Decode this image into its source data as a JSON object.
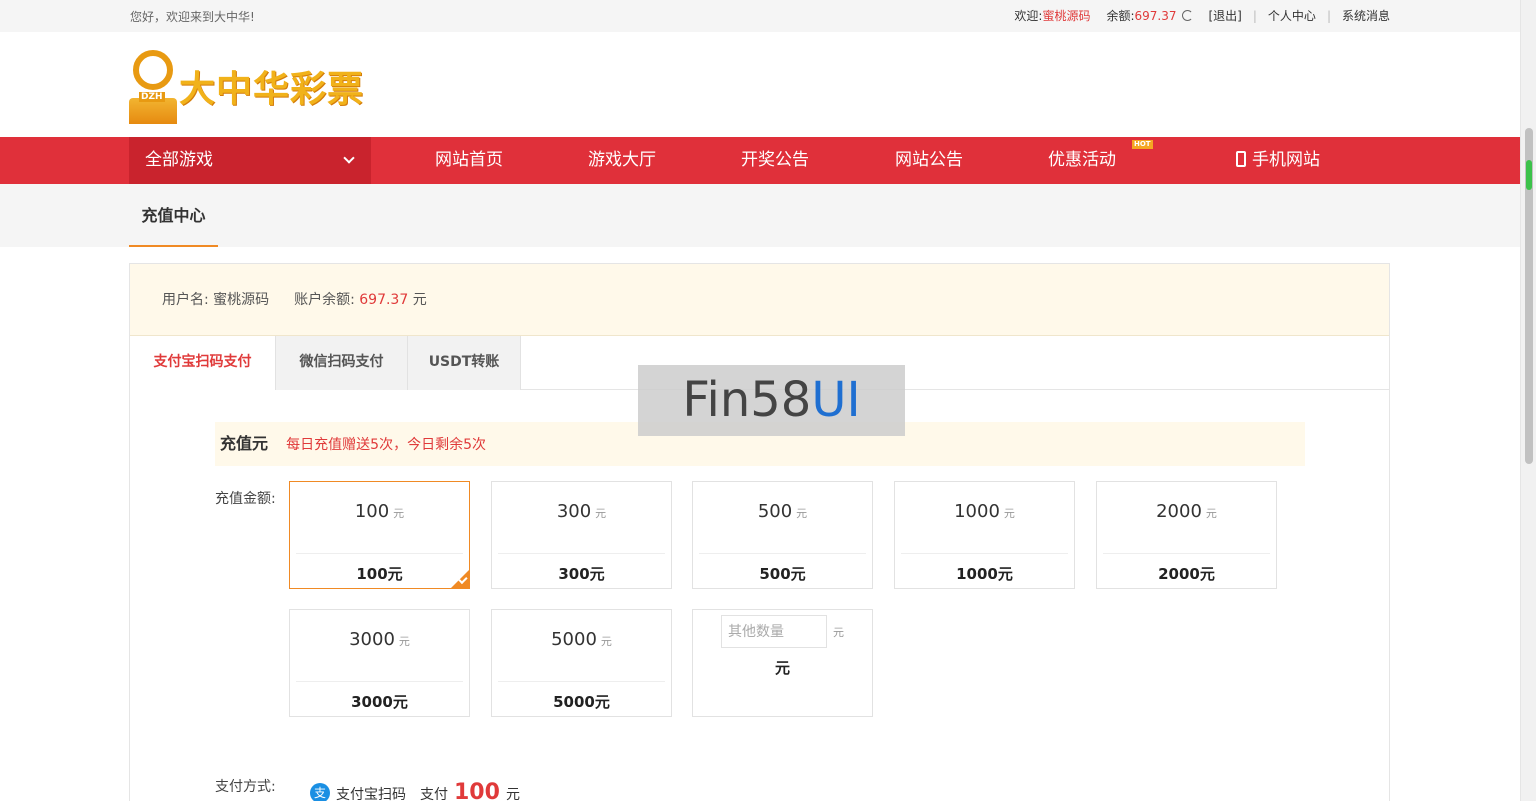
{
  "topbar": {
    "welcome": "您好，欢迎来到大中华!",
    "greeting_label": "欢迎:",
    "username": "蜜桃源码",
    "balance_label": "余额:",
    "balance_value": "697.37",
    "logout": "[退出]",
    "profile": "个人中心",
    "messages": "系统消息"
  },
  "logo": {
    "text": "大中华彩票",
    "badge": "DZH"
  },
  "nav": {
    "all_games": "全部游戏",
    "items": [
      "网站首页",
      "游戏大厅",
      "开奖公告",
      "网站公告",
      "优惠活动",
      "手机网站"
    ],
    "hot_badge": "HOT"
  },
  "page": {
    "title": "充值中心"
  },
  "userinfo": {
    "username_label": "用户名:",
    "username": "蜜桃源码",
    "balance_label": "账户余额:",
    "balance": "697.37",
    "unit": "元"
  },
  "tabs": [
    "支付宝扫码支付",
    "微信扫码支付",
    "USDT转账"
  ],
  "notice": {
    "label": "充值元",
    "message": "每日充值赠送5次，今日剩余5次"
  },
  "amount": {
    "label": "充值金额:",
    "unit": "元",
    "options": [
      {
        "value": "100",
        "caption": "100元",
        "selected": true
      },
      {
        "value": "300",
        "caption": "300元"
      },
      {
        "value": "500",
        "caption": "500元"
      },
      {
        "value": "1000",
        "caption": "1000元"
      },
      {
        "value": "2000",
        "caption": "2000元"
      },
      {
        "value": "3000",
        "caption": "3000元"
      },
      {
        "value": "5000",
        "caption": "5000元"
      }
    ],
    "other_placeholder": "其他数量",
    "other_unit": "元",
    "other_caption": "元"
  },
  "payment": {
    "label": "支付方式:",
    "method": "支付宝扫码",
    "pay_label": "支付",
    "amount": "100",
    "unit": "元",
    "icon_char": "支"
  },
  "watermark": {
    "part1": "Fin58",
    "part2": "UI"
  },
  "colors": {
    "brand_red": "#e0303a",
    "accent_orange": "#f08a24",
    "alipay_blue": "#1a8fe3"
  }
}
